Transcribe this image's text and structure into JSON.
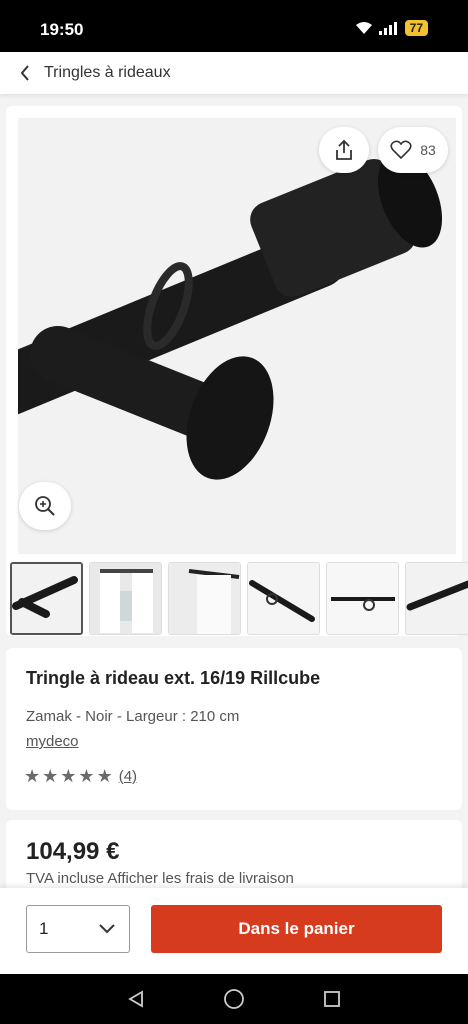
{
  "status_bar": {
    "time": "19:50",
    "battery": "77"
  },
  "nav": {
    "breadcrumb": "Tringles à rideaux"
  },
  "gallery": {
    "favorite_count": "83",
    "thumbnail_count": 6
  },
  "product": {
    "title": "Tringle à rideau ext. 16/19 Rillcube",
    "subtitle": "Zamak - Noir - Largeur : 210 cm",
    "brand": "mydeco",
    "rating_stars": 5,
    "review_count": "(4)"
  },
  "pricing": {
    "price": "104,99 €",
    "tax_note": "TVA incluse Afficher les frais de livraison"
  },
  "cart": {
    "quantity": "1",
    "button_label": "Dans le panier"
  },
  "colors": {
    "accent": "#d63b1e",
    "star": "#6b6b6b"
  }
}
